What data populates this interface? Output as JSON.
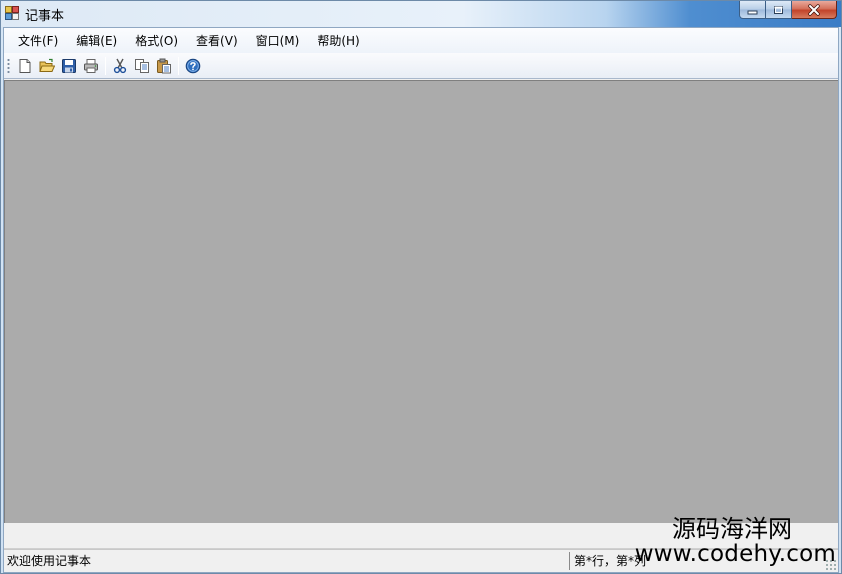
{
  "window": {
    "title": "记事本",
    "app_icon": "notepad-app-icon"
  },
  "caption_buttons": {
    "minimize_icon": "minimize-icon",
    "maximize_icon": "maximize-icon",
    "close_icon": "close-icon"
  },
  "menubar": {
    "items": [
      {
        "label": "文件(F)"
      },
      {
        "label": "编辑(E)"
      },
      {
        "label": "格式(O)"
      },
      {
        "label": "查看(V)"
      },
      {
        "label": "窗口(M)"
      },
      {
        "label": "帮助(H)"
      }
    ]
  },
  "toolbar": {
    "buttons": [
      {
        "icon": "new-file-icon"
      },
      {
        "icon": "open-folder-icon"
      },
      {
        "icon": "save-icon"
      },
      {
        "icon": "print-icon"
      },
      {
        "icon": "cut-icon"
      },
      {
        "icon": "copy-icon"
      },
      {
        "icon": "paste-icon"
      },
      {
        "icon": "help-icon"
      }
    ]
  },
  "statusbar": {
    "message": "欢迎使用记事本",
    "position": "第*行，第*列"
  },
  "watermark": {
    "line1": "源码海洋网",
    "line2": "www.codehy.com"
  },
  "colors": {
    "mdi_background": "#ababab",
    "titlebar_accent": "#3a7cc6",
    "close_button": "#c2432a"
  }
}
